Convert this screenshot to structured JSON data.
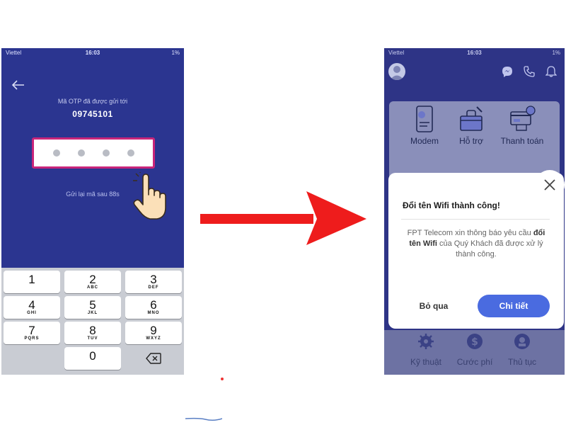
{
  "left_phone": {
    "status": {
      "carrier": "Viettel",
      "time": "16:03",
      "battery": "1%"
    },
    "otp_sent_label": "Mã OTP đã được gửi tới",
    "phone_number": "09745101",
    "otp_dots": 4,
    "resend_text": "Gửi lại mã sau 88s",
    "keypad": [
      [
        {
          "num": "1",
          "letters": ""
        },
        {
          "num": "2",
          "letters": "ABC"
        },
        {
          "num": "3",
          "letters": "DEF"
        }
      ],
      [
        {
          "num": "4",
          "letters": "GHI"
        },
        {
          "num": "5",
          "letters": "JKL"
        },
        {
          "num": "6",
          "letters": "MNO"
        }
      ],
      [
        {
          "num": "7",
          "letters": "PQRS"
        },
        {
          "num": "8",
          "letters": "TUV"
        },
        {
          "num": "9",
          "letters": "WXYZ"
        }
      ],
      [
        {
          "num": "",
          "letters": ""
        },
        {
          "num": "0",
          "letters": ""
        },
        {
          "num": "",
          "letters": ""
        }
      ]
    ]
  },
  "right_phone": {
    "status": {
      "carrier": "Viettel",
      "time": "16:03",
      "battery": "1%"
    },
    "services": [
      {
        "label": "Modem",
        "icon": "modem-icon"
      },
      {
        "label": "Hỗ trợ",
        "icon": "support-icon"
      },
      {
        "label": "Thanh toán",
        "icon": "payment-icon"
      }
    ],
    "bottom_nav": [
      {
        "label": "Kỹ thuật",
        "icon": "gear-icon"
      },
      {
        "label": "Cước phí",
        "icon": "dollar-icon"
      },
      {
        "label": "Thủ tục",
        "icon": "procedure-icon"
      }
    ],
    "dialog": {
      "title": "Đổi tên Wifi thành công!",
      "body_prefix": "FPT Telecom xin thông báo yêu cầu",
      "body_bold": "đổi tên Wifi",
      "body_suffix": "của Quý Khách đã được xử lý thành công.",
      "skip_label": "Bỏ qua",
      "detail_label": "Chi tiết"
    }
  },
  "colors": {
    "phone_bg": "#2b3590",
    "otp_border": "#c8257a",
    "arrow": "#ee1c1c",
    "primary_button": "#4a6be0"
  }
}
